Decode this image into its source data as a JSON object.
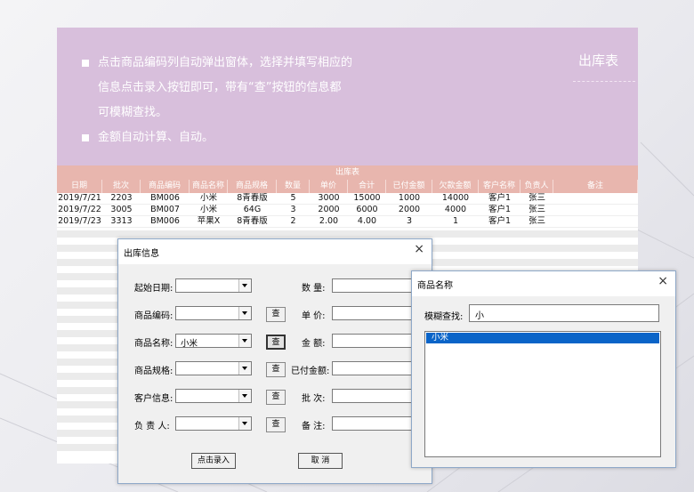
{
  "banner": {
    "bullets": [
      "点击商品编码列自动弹出窗体，选择并填写相应的信息点击录入按钮即可，带有“查”按钮的信息都可模糊查找。",
      "金额自动计算、自动。"
    ],
    "bullet_lines": [
      [
        "点击商品编码列自动弹出窗体，选择并填写相应的",
        "信息点击录入按钮即可，带有“查”按钮的信息都",
        "可模糊查找。"
      ],
      [
        "金额自动计算、自动。"
      ]
    ],
    "title": "出库表"
  },
  "sheet": {
    "title": "出库表",
    "columns": [
      "日期",
      "批次",
      "商品编码",
      "商品名称",
      "商品规格",
      "数量",
      "单价",
      "合计",
      "已付金额",
      "欠款金额",
      "客户名称",
      "负责人",
      "备注"
    ],
    "rows": [
      [
        "2019/7/21",
        "2203",
        "BM006",
        "小米",
        "8青春版",
        "5",
        "3000",
        "15000",
        "1000",
        "14000",
        "客户1",
        "张三",
        ""
      ],
      [
        "2019/7/22",
        "3005",
        "BM007",
        "小米",
        "64G",
        "3",
        "2000",
        "6000",
        "2000",
        "4000",
        "客户1",
        "张三",
        ""
      ],
      [
        "2019/7/23",
        "3313",
        "BM006",
        "苹果X",
        "8青春版",
        "2",
        "2.00",
        "4.00",
        "3",
        "1",
        "客户1",
        "张三",
        ""
      ]
    ]
  },
  "form": {
    "title": "出库信息",
    "close": "×",
    "left_fields": [
      {
        "label": "起始日期:",
        "value": ""
      },
      {
        "label": "商品编码:",
        "value": ""
      },
      {
        "label": "商品名称:",
        "value": "小米"
      },
      {
        "label": "商品规格:",
        "value": ""
      },
      {
        "label": "客户信息:",
        "value": ""
      },
      {
        "label": "负 责 人:",
        "value": ""
      }
    ],
    "search_btn": "查",
    "right_fields": [
      {
        "label": "数 量:",
        "value": ""
      },
      {
        "label": "单 价:",
        "value": ""
      },
      {
        "label": "金 额:",
        "value": ""
      },
      {
        "label": "已付金额:",
        "value": ""
      },
      {
        "label": "批 次:",
        "value": ""
      },
      {
        "label": "备 注:",
        "value": ""
      }
    ],
    "submit": "点击录入",
    "cancel": "取 消"
  },
  "lookup": {
    "title": "商品名称",
    "close": "×",
    "search_label": "模糊查找:",
    "search_value": "小",
    "results": [
      "小米"
    ]
  }
}
